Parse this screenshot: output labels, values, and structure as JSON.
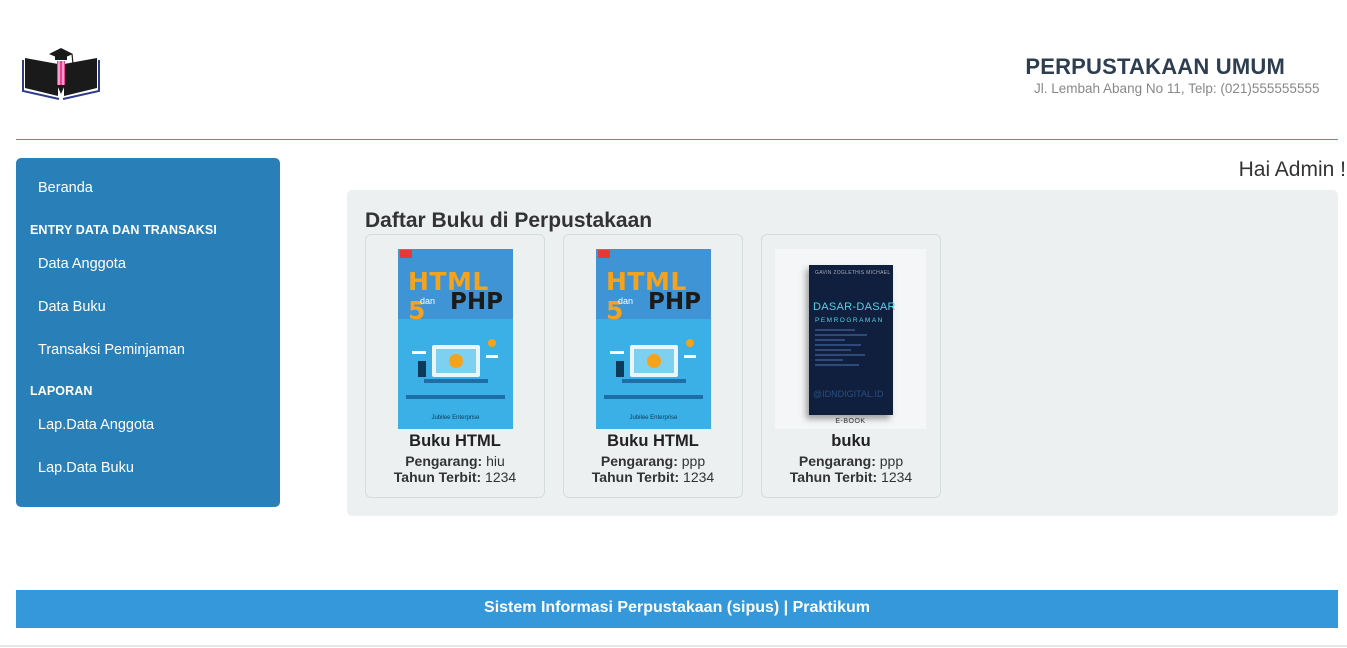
{
  "header": {
    "title": "PERPUSTAKAAN UMUM",
    "address": "Jl. Lembah Abang No 11, Telp: (021)555555555",
    "logo_icon": "library-logo-icon",
    "accent_line_color": "#2aa3b5"
  },
  "sidebar": {
    "background_color": "#2980b9",
    "beranda": "Beranda",
    "section_entry": "ENTRY DATA DAN TRANSAKSI",
    "data_anggota": "Data Anggota",
    "data_buku": "Data Buku",
    "transaksi": "Transaksi Peminjaman",
    "section_laporan": "LAPORAN",
    "lap_anggota": "Lap.Data Anggota",
    "lap_buku": "Lap.Data Buku"
  },
  "greeting": "Hai Admin !",
  "main": {
    "title": "Daftar Buku di Perpustakaan",
    "pengarang_label": "Pengarang:",
    "tahun_label": "Tahun Terbit:",
    "books": [
      {
        "title": "Buku HTML",
        "pengarang": "hiu",
        "tahun": "1234",
        "cover": {
          "line1": "HTML 5",
          "line2": "dan",
          "line3": "PHP",
          "publisher": "Jubilee Enterprise"
        }
      },
      {
        "title": "Buku HTML",
        "pengarang": "ppp",
        "tahun": "1234",
        "cover": {
          "line1": "HTML 5",
          "line2": "dan",
          "line3": "PHP",
          "publisher": "Jubilee Enterprise"
        }
      },
      {
        "title": "buku",
        "pengarang": "ppp",
        "tahun": "1234",
        "cover": {
          "author": "GAVIN ZOGLETHIS MICHAEL",
          "line1": "DASAR-DASAR",
          "line2": "PEMROGRAMAN",
          "watermark": "@IDNDIGITAL.ID",
          "tag": "E-BOOK"
        }
      }
    ]
  },
  "footer": {
    "text": "Sistem Informasi Perpustakaan (sipus) | Praktikum",
    "background_color": "#3498db"
  }
}
